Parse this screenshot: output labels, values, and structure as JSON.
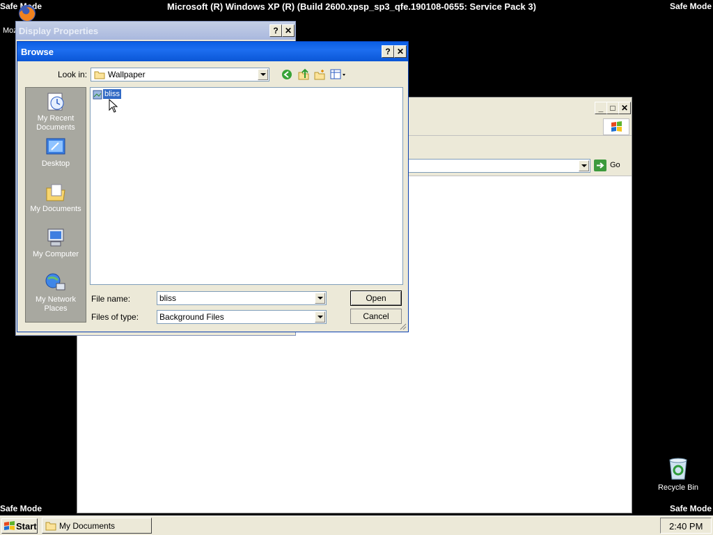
{
  "desktop": {
    "safe_mode_tl": "Safe Mode",
    "safe_mode_tr": "Safe Mode",
    "safe_mode_bl": "Safe Mode",
    "safe_mode_br": "Safe Mode",
    "os_banner": "Microsoft (R) Windows XP (R) (Build 2600.xpsp_sp3_qfe.190108-0655: Service Pack 3)",
    "firefox_label": "Moz",
    "recycle_bin_label": "Recycle Bin"
  },
  "background_window": {
    "address_go_label": "Go"
  },
  "display_properties": {
    "title": "Display Properties",
    "help": "?",
    "close": "✕"
  },
  "browse": {
    "title": "Browse",
    "help": "?",
    "close": "✕",
    "look_in_label": "Look in:",
    "look_in_value": "Wallpaper",
    "places": [
      {
        "label_1": "My Recent",
        "label_2": "Documents"
      },
      {
        "label_1": "Desktop"
      },
      {
        "label_1": "My Documents"
      },
      {
        "label_1": "My Computer"
      },
      {
        "label_1": "My Network",
        "label_2": "Places"
      }
    ],
    "files": [
      {
        "name": "bliss",
        "selected": true
      }
    ],
    "file_name_label": "File name:",
    "file_name_value": "bliss",
    "files_of_type_label": "Files of type:",
    "files_of_type_value": "Background Files",
    "open_label": "Open",
    "cancel_label": "Cancel"
  },
  "taskbar": {
    "start_label": "Start",
    "task_label": "My Documents",
    "clock": "2:40 PM"
  },
  "colors": {
    "desktop_bg": "#000000",
    "title_active": "#0a5ee4",
    "title_inactive": "#a9b8de",
    "dialog_bg": "#ece9d8",
    "places_bar": "#a8a8a0",
    "selection": "#316ac5"
  }
}
